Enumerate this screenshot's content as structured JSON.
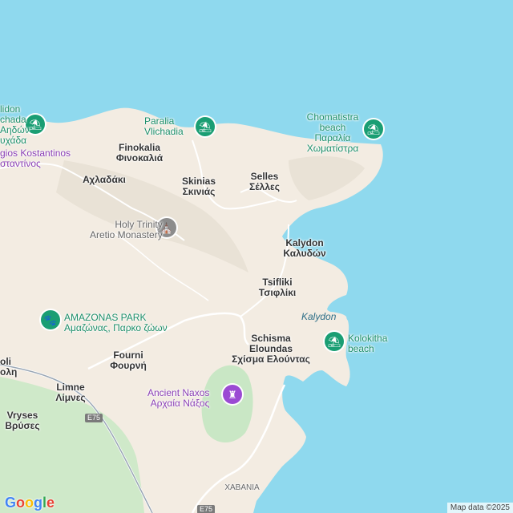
{
  "map": {
    "colors": {
      "water": "#8fd9ee",
      "land": "#f3ece2",
      "park": "#c9e7c5",
      "road": "#ffffff",
      "route": "#9aa7b5"
    },
    "places": {
      "finokalia": {
        "en": "Finokalia",
        "gr": "Φινοκαλιά"
      },
      "achladaki": {
        "en": "Αχλαδάκι"
      },
      "skinias": {
        "en": "Skinias",
        "gr": "Σκινιάς"
      },
      "selles": {
        "en": "Selles",
        "gr": "Σέλλες"
      },
      "kalydon": {
        "en": "Kalydon",
        "gr": "Καλυδών"
      },
      "tsifliki": {
        "en": "Tsifliki",
        "gr": "Τσιφλίκι"
      },
      "kalydon_water": "Kalydon",
      "schisma": {
        "en1": "Schisma",
        "en2": "Eloundas",
        "gr": "Σχίσμα Ελούντας"
      },
      "fourni": {
        "en": "Fourni",
        "gr": "Φουρνή"
      },
      "limne": {
        "en": "Limne",
        "gr": "Λίμνες"
      },
      "vryses": {
        "en": "Vryses",
        "gr": "Βρύσες"
      },
      "noli": {
        "en": "oli",
        "gr": "ολη"
      },
      "chavania": "ΧΑΒΑΝΙΑ"
    },
    "pois": {
      "lidon": {
        "en1": "lidon",
        "en2": "chada",
        "gr1": "Αηδών",
        "gr2": "υχάδα",
        "icon": "beach-icon"
      },
      "agios": {
        "en": "gios Kostantinos",
        "gr": "σταντίνος"
      },
      "paralia_vlichadia": {
        "en1": "Paralia",
        "en2": "Vlichadia",
        "icon": "beach-icon"
      },
      "chomatistra": {
        "en1": "Chomatistra",
        "en2": "beach",
        "gr1": "Παραλία",
        "gr2": "Χωματίστρα",
        "icon": "beach-icon"
      },
      "holy_trinity": {
        "en1": "Holy Trinity",
        "en2": "Aretio Monastery",
        "icon": "monastery-icon"
      },
      "amazonas": {
        "en": "AMAZONAS PARK",
        "gr": "Αμαζώνας, Παρκο ζώων",
        "icon": "paw-icon"
      },
      "kolokitha": {
        "en1": "Kolokitha",
        "en2": "beach",
        "icon": "beach-icon"
      },
      "ancient_naxos": {
        "en": "Ancient Naxos",
        "gr": "Αρχαία Νάξος",
        "icon": "ruins-icon"
      }
    },
    "roads": {
      "e75_a": "E75",
      "e75_b": "E75"
    },
    "footer": {
      "logo": [
        "G",
        "o",
        "o",
        "g",
        "l",
        "e"
      ],
      "attribution": "Map data ©2025"
    }
  }
}
